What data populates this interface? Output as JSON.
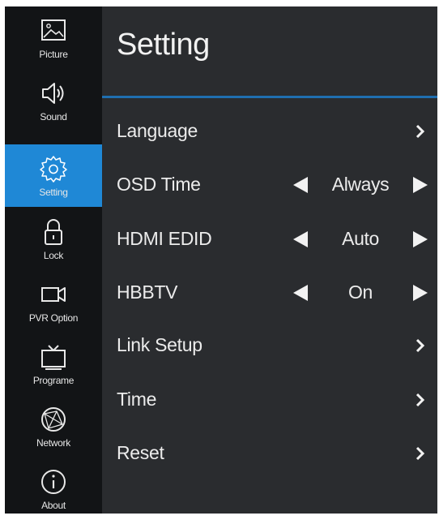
{
  "sidebar": {
    "items": [
      {
        "label": "Picture",
        "icon": "picture-icon",
        "active": false
      },
      {
        "label": "Sound",
        "icon": "speaker-icon",
        "active": false
      },
      {
        "label": "Setting",
        "icon": "gear-icon",
        "active": true
      },
      {
        "label": "Lock",
        "icon": "lock-icon",
        "active": false
      },
      {
        "label": "PVR Option",
        "icon": "camera-icon",
        "active": false
      },
      {
        "label": "Programe",
        "icon": "tv-icon",
        "active": false
      },
      {
        "label": "Network",
        "icon": "globe-icon",
        "active": false
      },
      {
        "label": "About",
        "icon": "info-icon",
        "active": false
      }
    ]
  },
  "main": {
    "title": "Setting",
    "rows": [
      {
        "label": "Language",
        "type": "submenu"
      },
      {
        "label": "OSD Time",
        "type": "selector",
        "value": "Always"
      },
      {
        "label": "HDMI EDID",
        "type": "selector",
        "value": "Auto"
      },
      {
        "label": "HBBTV",
        "type": "selector",
        "value": "On"
      },
      {
        "label": "Link Setup",
        "type": "submenu"
      },
      {
        "label": "Time",
        "type": "submenu"
      },
      {
        "label": "Reset",
        "type": "submenu"
      }
    ]
  },
  "colors": {
    "sidebar_bg": "#121416",
    "content_bg": "#2a2c2f",
    "accent": "#1f88d6",
    "divider": "#1f6fb0",
    "text": "#ececec"
  }
}
